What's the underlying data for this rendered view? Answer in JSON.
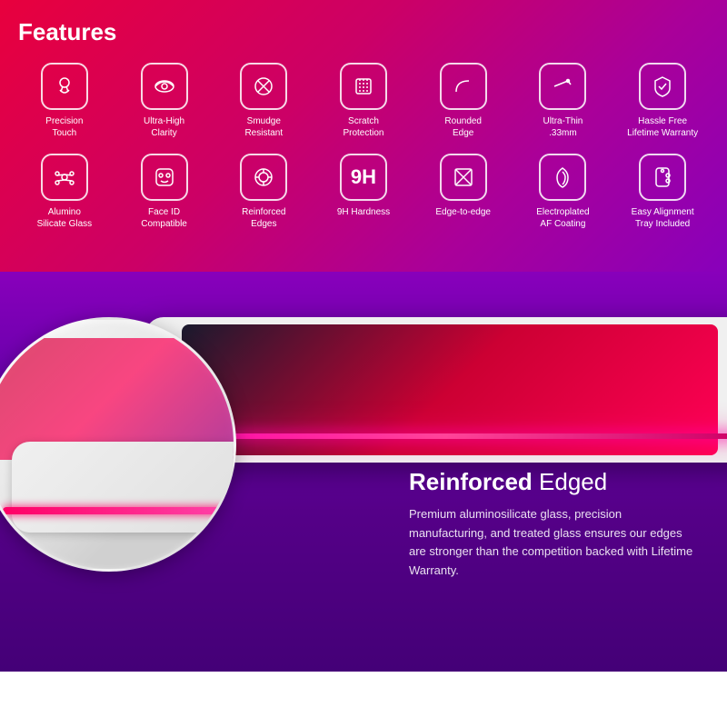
{
  "header": {
    "title": "Features"
  },
  "features_row1": [
    {
      "id": "precision-touch",
      "label": "Precision\nTouch",
      "icon": "touch"
    },
    {
      "id": "ultra-high-clarity",
      "label": "Ultra-High\nClarity",
      "icon": "eye"
    },
    {
      "id": "smudge-resistant",
      "label": "Smudge\nResistant",
      "icon": "smudge"
    },
    {
      "id": "scratch-protection",
      "label": "Scratch\nProtection",
      "icon": "scratch"
    },
    {
      "id": "rounded-edge",
      "label": "Rounded\nEdge",
      "icon": "rounded"
    },
    {
      "id": "ultra-thin",
      "label": "Ultra-Thin\n.33mm",
      "icon": "thin"
    },
    {
      "id": "hassle-free",
      "label": "Hassle Free\nLifetime Warranty",
      "icon": "shield"
    }
  ],
  "features_row2": [
    {
      "id": "alumino-silicate",
      "label": "Alumino\nSilicate Glass",
      "icon": "molecule"
    },
    {
      "id": "face-id",
      "label": "Face ID\nCompatible",
      "icon": "faceid"
    },
    {
      "id": "reinforced-edges",
      "label": "Reinforced\nEdges",
      "icon": "reinforced"
    },
    {
      "id": "9h-hardness",
      "label": "9H Hardness",
      "icon": "9h"
    },
    {
      "id": "edge-to-edge",
      "label": "Edge-to-edge",
      "icon": "edge"
    },
    {
      "id": "electroplated",
      "label": "Electroplated\nAF Coating",
      "icon": "leaf"
    },
    {
      "id": "easy-alignment",
      "label": "Easy Alignment\nTray Included",
      "icon": "tray"
    }
  ],
  "reinforced_section": {
    "title_bold": "Reinforced",
    "title_normal": " Edged",
    "description": "Premium aluminosilicate glass, precision manufacturing, and treated glass ensures our edges are stronger than the competition backed with Lifetime Warranty."
  }
}
